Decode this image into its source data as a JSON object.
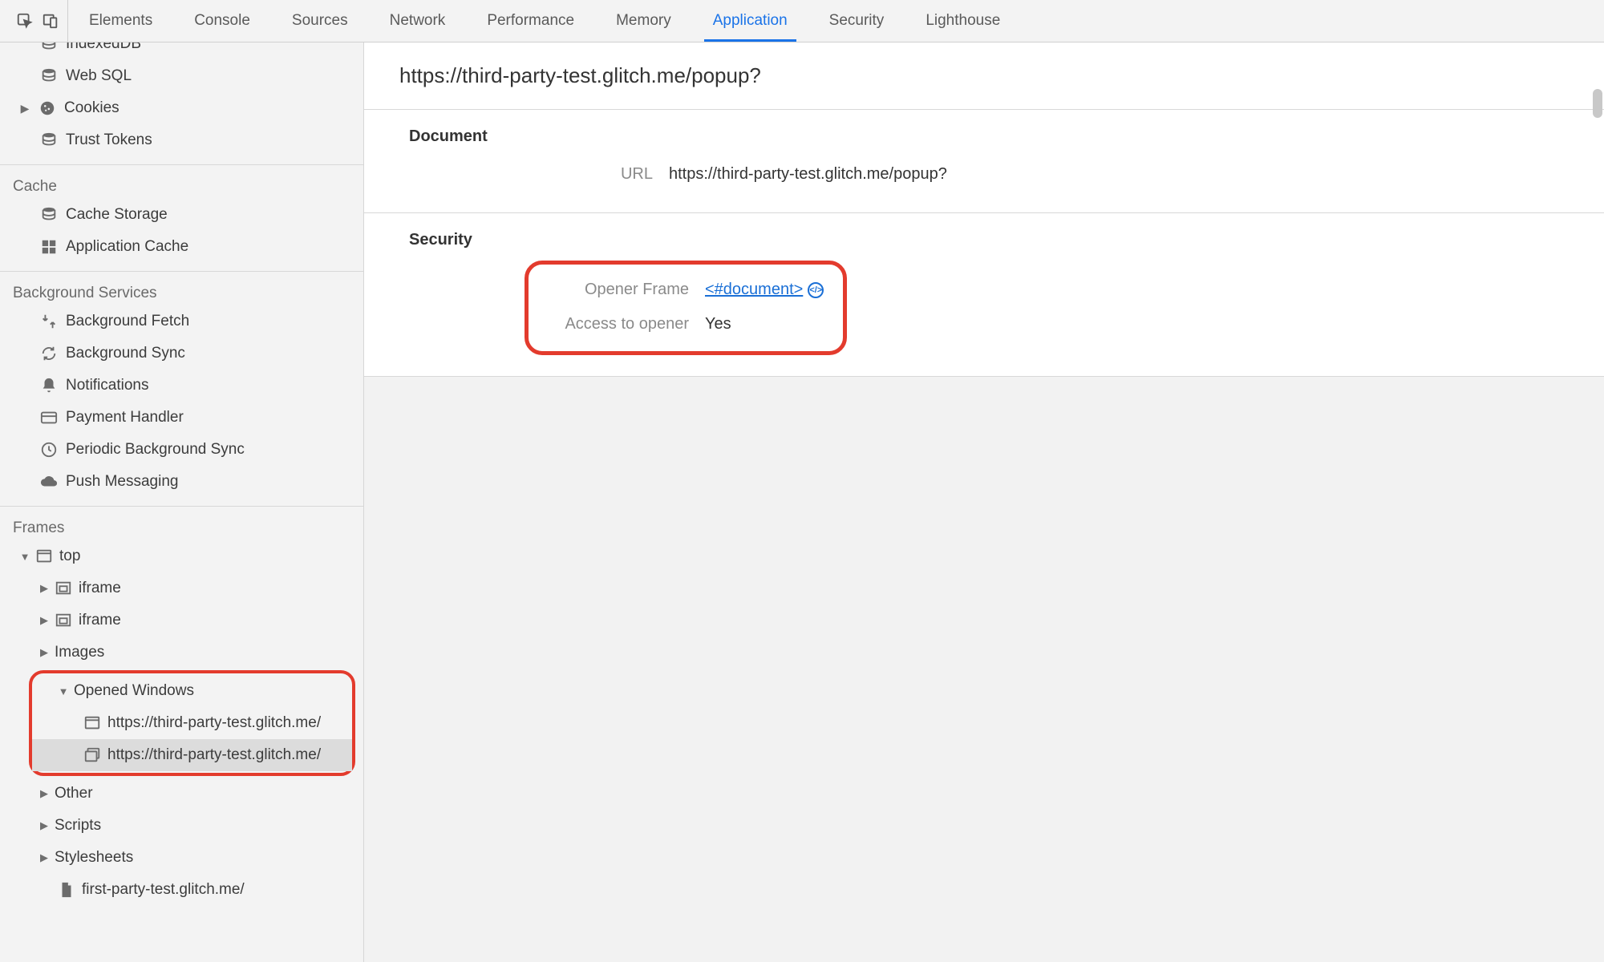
{
  "tabs": {
    "items": [
      "Elements",
      "Console",
      "Sources",
      "Network",
      "Performance",
      "Memory",
      "Application",
      "Security",
      "Lighthouse"
    ],
    "active": "Application"
  },
  "sidebar": {
    "storage": {
      "items": [
        "IndexedDB",
        "Web SQL",
        "Cookies",
        "Trust Tokens"
      ]
    },
    "cache": {
      "title": "Cache",
      "items": [
        "Cache Storage",
        "Application Cache"
      ]
    },
    "background": {
      "title": "Background Services",
      "items": [
        "Background Fetch",
        "Background Sync",
        "Notifications",
        "Payment Handler",
        "Periodic Background Sync",
        "Push Messaging"
      ]
    },
    "frames": {
      "title": "Frames",
      "top": "top",
      "iframe1": "iframe",
      "iframe2": "iframe",
      "images": "Images",
      "opened_windows": "Opened Windows",
      "win1": "https://third-party-test.glitch.me/",
      "win2": "https://third-party-test.glitch.me/",
      "other": "Other",
      "scripts": "Scripts",
      "stylesheets": "Stylesheets",
      "leaf": "first-party-test.glitch.me/"
    }
  },
  "content": {
    "title": "https://third-party-test.glitch.me/popup?",
    "document": {
      "heading": "Document",
      "url_label": "URL",
      "url_value": "https://third-party-test.glitch.me/popup?"
    },
    "security": {
      "heading": "Security",
      "opener_label": "Opener Frame",
      "opener_value": "<#document>",
      "access_label": "Access to opener",
      "access_value": "Yes"
    }
  }
}
